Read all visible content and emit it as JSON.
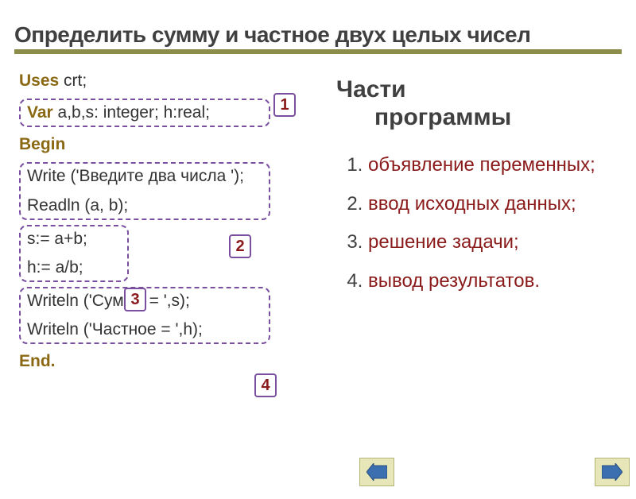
{
  "title": "Определить сумму и частное двух целых чисел",
  "code": {
    "uses_kw": "Uses",
    "uses_rest": " crt;",
    "var_kw": "Var",
    "var_rest": " a,b,s: integer; h:real;",
    "begin_kw": "Begin",
    "write_line": "Write ('Введите два числа ');",
    "read_line": "Readln (a, b);",
    "calc1": "s:= a+b;",
    "calc2": "h:= a/b;",
    "out1": "Writeln ('Сумма = ',s);",
    "out2": "Writeln ('Частное = ',h);",
    "end_kw": "End."
  },
  "labels": {
    "n1": "1",
    "n2": "2",
    "n3": "3",
    "n4": "4"
  },
  "parts_title_l1": "Части",
  "parts_title_l2": "программы",
  "parts": [
    "объявление переменных;",
    "ввод исходных данных;",
    "решение задачи;",
    "вывод результатов."
  ]
}
